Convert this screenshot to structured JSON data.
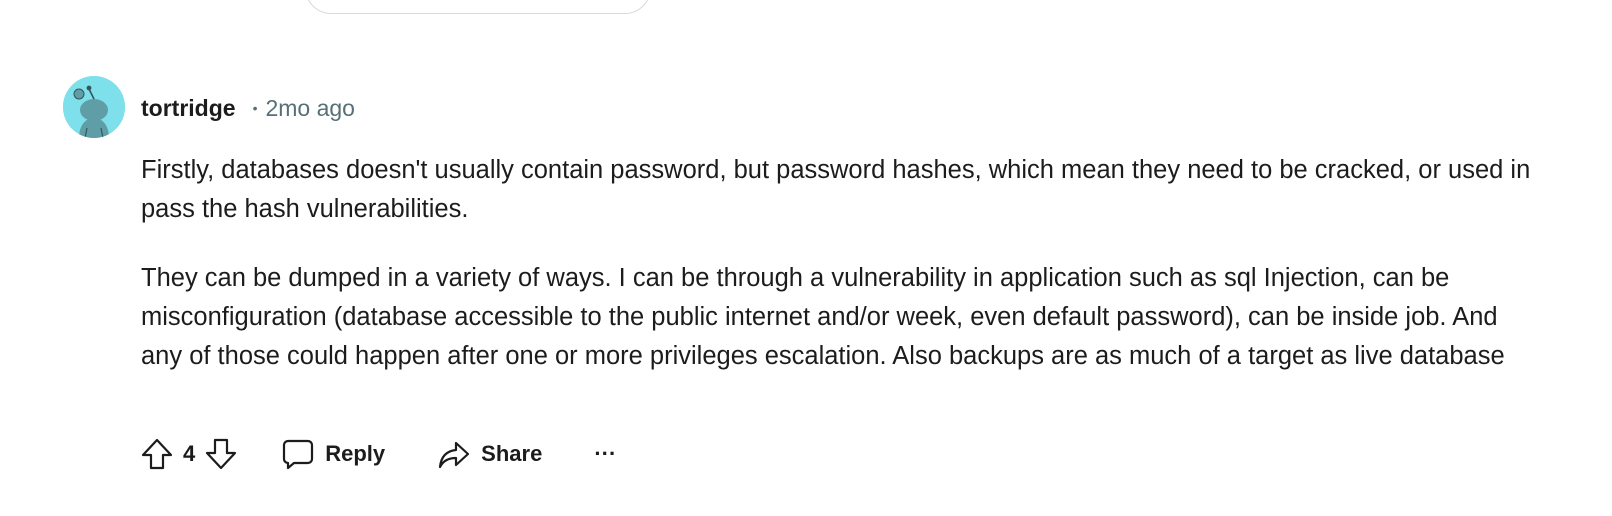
{
  "comment": {
    "username": "tortridge",
    "separator": "•",
    "time": "2mo ago",
    "paragraphs": [
      "Firstly, databases doesn't usually contain password, but password hashes, which mean they need to be cracked, or used in pass the hash vulnerabilities.",
      "They can be dumped in a variety of ways. I can be through a vulnerability in application such as sql Injection, can be misconfiguration (database accessible to the public internet and/or week, even default password), can be inside job. And any of those could happen after one or more privileges escalation. Also backups are as much of a target as live database"
    ],
    "score": "4"
  },
  "actions": {
    "reply_label": "Reply",
    "share_label": "Share",
    "more_label": "···"
  },
  "icons": {
    "avatar": "reddit-snoo-avatar-icon",
    "upvote": "upvote-arrow-icon",
    "downvote": "downvote-arrow-icon",
    "reply": "speech-bubble-icon",
    "share": "share-arrow-icon"
  },
  "colors": {
    "avatar_bg": "#7ee0ea",
    "text": "#1c1c1c",
    "meta": "#576f76"
  }
}
